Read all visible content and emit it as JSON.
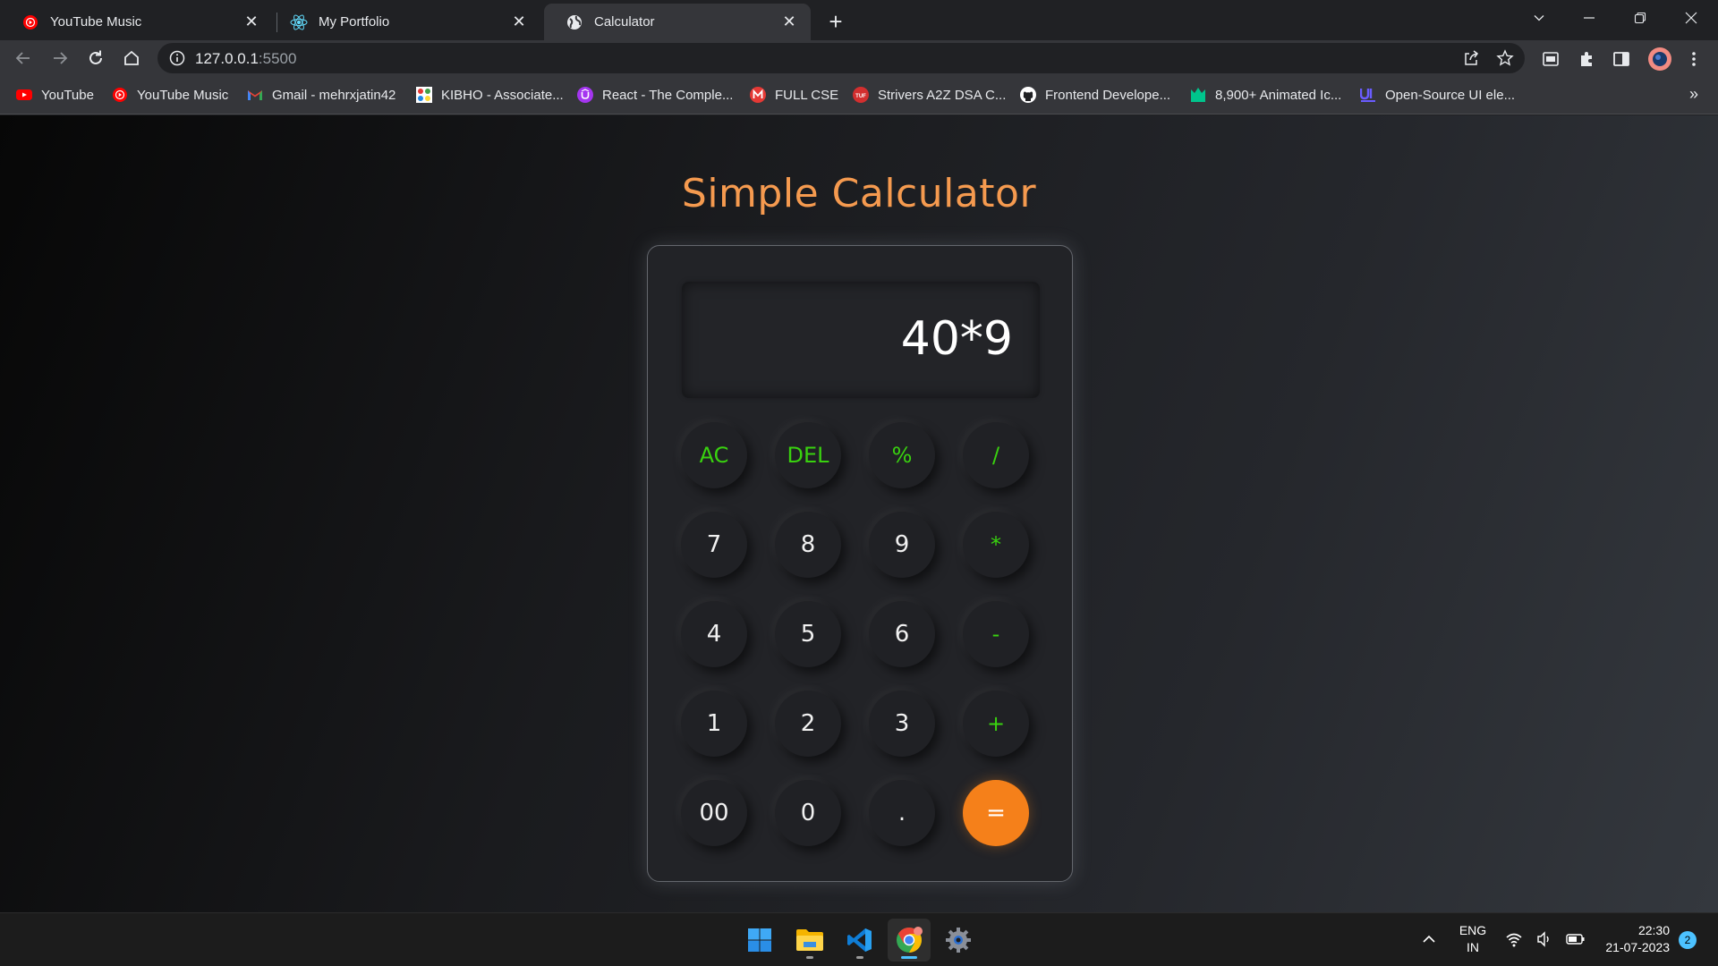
{
  "browser": {
    "tabs": [
      {
        "title": "YouTube Music",
        "favicon": "youtube-music-icon"
      },
      {
        "title": "My Portfolio",
        "favicon": "react-icon"
      },
      {
        "title": "Calculator",
        "favicon": "globe-icon",
        "active": true
      }
    ],
    "address": {
      "host": "127.0.0.1",
      "port": ":5500"
    },
    "bookmarks": [
      {
        "label": "YouTube",
        "icon": "youtube-icon"
      },
      {
        "label": "YouTube Music",
        "icon": "youtube-music-icon"
      },
      {
        "label": "Gmail - mehrxjatin42",
        "icon": "gmail-icon"
      },
      {
        "label": "KIBHO - Associate...",
        "icon": "kibho-icon"
      },
      {
        "label": "React - The Comple...",
        "icon": "udemy-icon"
      },
      {
        "label": "FULL CSE",
        "icon": "m-icon"
      },
      {
        "label": "Strivers A2Z DSA C...",
        "icon": "tuf-icon"
      },
      {
        "label": "Frontend Develope...",
        "icon": "github-icon"
      },
      {
        "label": "8,900+ Animated Ic...",
        "icon": "animated-icons-icon"
      },
      {
        "label": "Open-Source UI ele...",
        "icon": "uiverse-icon"
      }
    ],
    "more_bookmarks": "»"
  },
  "page": {
    "title": "Simple Calculator",
    "display": "40*9",
    "keys": [
      {
        "label": "AC",
        "type": "op"
      },
      {
        "label": "DEL",
        "type": "op"
      },
      {
        "label": "%",
        "type": "op"
      },
      {
        "label": "/",
        "type": "op"
      },
      {
        "label": "7",
        "type": "num"
      },
      {
        "label": "8",
        "type": "num"
      },
      {
        "label": "9",
        "type": "num"
      },
      {
        "label": "*",
        "type": "op"
      },
      {
        "label": "4",
        "type": "num"
      },
      {
        "label": "5",
        "type": "num"
      },
      {
        "label": "6",
        "type": "num"
      },
      {
        "label": "-",
        "type": "op"
      },
      {
        "label": "1",
        "type": "num"
      },
      {
        "label": "2",
        "type": "num"
      },
      {
        "label": "3",
        "type": "num"
      },
      {
        "label": "+",
        "type": "op"
      },
      {
        "label": "00",
        "type": "num"
      },
      {
        "label": "0",
        "type": "num"
      },
      {
        "label": ".",
        "type": "num"
      },
      {
        "label": "=",
        "type": "eq"
      }
    ],
    "colors": {
      "accent": "#f5801a",
      "operator": "#39d20f",
      "title": "#f59a4f"
    }
  },
  "taskbar": {
    "apps": [
      "windows-start-icon",
      "file-explorer-icon",
      "vscode-icon",
      "chrome-icon",
      "settings-icon"
    ],
    "lang_top": "ENG",
    "lang_bottom": "IN",
    "time": "22:30",
    "date": "21-07-2023",
    "notifications": "2"
  }
}
